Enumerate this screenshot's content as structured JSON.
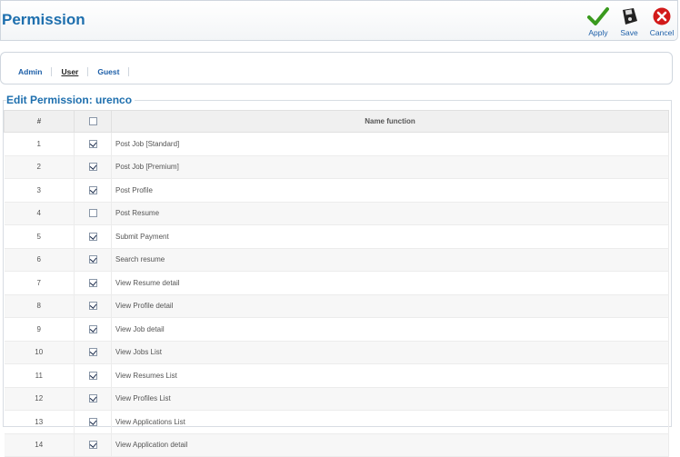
{
  "header": {
    "title": "Permission",
    "toolbar": [
      {
        "name": "apply",
        "label": "Apply",
        "icon": "check-icon",
        "color": "#3a9a1e"
      },
      {
        "name": "save",
        "label": "Save",
        "icon": "floppy-disk-icon",
        "color": "#222222"
      },
      {
        "name": "cancel",
        "label": "Cancel",
        "icon": "cancel-icon",
        "color": "#d21a1a"
      }
    ]
  },
  "tabs": [
    {
      "label": "Admin",
      "active": false
    },
    {
      "label": "User",
      "active": true
    },
    {
      "label": "Guest",
      "active": false
    }
  ],
  "edit": {
    "legend": "Edit Permission: urenco"
  },
  "table": {
    "headers": {
      "num": "#",
      "name": "Name function"
    },
    "header_checked": false,
    "rows": [
      {
        "num": "1",
        "name": "Post Job [Standard]",
        "checked": true
      },
      {
        "num": "2",
        "name": "Post Job [Premium]",
        "checked": true
      },
      {
        "num": "3",
        "name": "Post Profile",
        "checked": true
      },
      {
        "num": "4",
        "name": "Post Resume",
        "checked": false
      },
      {
        "num": "5",
        "name": "Submit Payment",
        "checked": true
      },
      {
        "num": "6",
        "name": "Search resume",
        "checked": true
      },
      {
        "num": "7",
        "name": "View Resume detail",
        "checked": true
      },
      {
        "num": "8",
        "name": "View Profile detail",
        "checked": true
      },
      {
        "num": "9",
        "name": "View Job detail",
        "checked": true
      },
      {
        "num": "10",
        "name": "View Jobs List",
        "checked": true
      },
      {
        "num": "11",
        "name": "View Resumes List",
        "checked": true
      },
      {
        "num": "12",
        "name": "View Profiles List",
        "checked": true
      },
      {
        "num": "13",
        "name": "View Applications List",
        "checked": true
      },
      {
        "num": "14",
        "name": "View Application detail",
        "checked": true
      }
    ]
  }
}
